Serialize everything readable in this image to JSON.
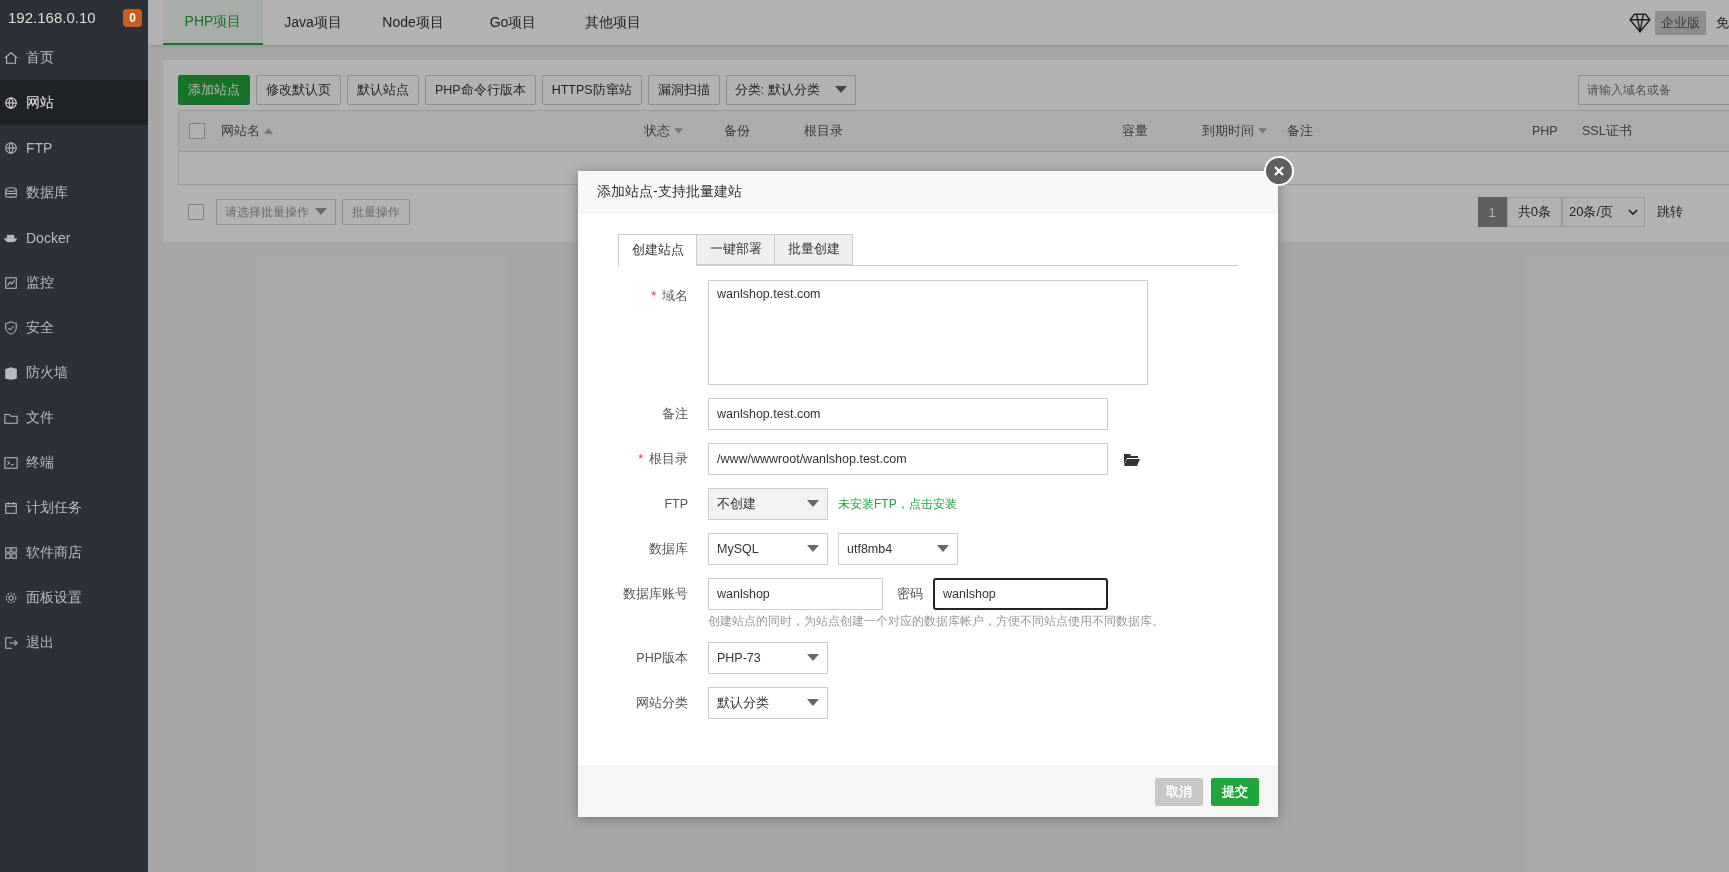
{
  "sidebar": {
    "host": "192.168.0.10",
    "badge": "0",
    "items": [
      {
        "label": "首页",
        "selected": false
      },
      {
        "label": "网站",
        "selected": true
      },
      {
        "label": "FTP",
        "selected": false
      },
      {
        "label": "数据库",
        "selected": false
      },
      {
        "label": "Docker",
        "selected": false
      },
      {
        "label": "监控",
        "selected": false
      },
      {
        "label": "安全",
        "selected": false
      },
      {
        "label": "防火墙",
        "selected": false
      },
      {
        "label": "文件",
        "selected": false
      },
      {
        "label": "终端",
        "selected": false
      },
      {
        "label": "计划任务",
        "selected": false
      },
      {
        "label": "软件商店",
        "selected": false
      },
      {
        "label": "面板设置",
        "selected": false
      },
      {
        "label": "退出",
        "selected": false
      }
    ]
  },
  "top_tabs": [
    {
      "label": "PHP项目",
      "selected": true
    },
    {
      "label": "Java项目",
      "selected": false
    },
    {
      "label": "Node项目",
      "selected": false
    },
    {
      "label": "Go项目",
      "selected": false
    },
    {
      "label": "其他项目",
      "selected": false
    }
  ],
  "edition": "企业版",
  "free": "免",
  "toolbar": {
    "buttons": [
      {
        "label": "添加站点",
        "primary": true
      },
      {
        "label": "修改默认页",
        "primary": false
      },
      {
        "label": "默认站点",
        "primary": false
      },
      {
        "label": "PHP命令行版本",
        "primary": false
      },
      {
        "label": "HTTPS防窜站",
        "primary": false
      },
      {
        "label": "漏洞扫描",
        "primary": false
      }
    ],
    "category": "分类: 默认分类",
    "search_placeholder": "请输入域名或备"
  },
  "table": {
    "checked": false,
    "columns": [
      {
        "label": "网站名",
        "sort_up": true
      },
      {
        "label": "状态",
        "sort_up": false
      },
      {
        "label": "备份"
      },
      {
        "label": "根目录"
      },
      {
        "label": "容量"
      },
      {
        "label": "到期时间",
        "sort_up": false
      },
      {
        "label": "备注"
      },
      {
        "label": "PHP"
      },
      {
        "label": "SSL证书"
      }
    ]
  },
  "footer": {
    "checked": false,
    "batch_select": "请选择批量操作",
    "batch_button": "批量操作",
    "page": "1",
    "total": "共0条",
    "per_page": "20条/页",
    "jump": "跳转"
  },
  "dialog": {
    "title": "添加站点-支持批量建站",
    "tabs": [
      {
        "label": "创建站点",
        "selected": true
      },
      {
        "label": "一键部署",
        "selected": false
      },
      {
        "label": "批量创建",
        "selected": false
      }
    ],
    "rows": [
      {
        "label": "域名",
        "required_mark": "*",
        "controls": [
          {
            "kind": "textarea",
            "value": "wanlshop.test.com"
          }
        ]
      },
      {
        "label": "备注",
        "controls": [
          {
            "kind": "input",
            "value": "wanlshop.test.com",
            "wide": true
          }
        ]
      },
      {
        "label": "根目录",
        "required_mark": "*",
        "controls": [
          {
            "kind": "input",
            "value": "/www/wwwroot/wanlshop.test.com",
            "wide": true
          },
          {
            "kind": "folder"
          }
        ]
      },
      {
        "label": "FTP",
        "controls": [
          {
            "kind": "select",
            "value": "不创建",
            "disabled": true
          },
          {
            "kind": "link",
            "value": "未安装FTP，点击安装"
          }
        ]
      },
      {
        "label": "数据库",
        "controls": [
          {
            "kind": "select",
            "value": "MySQL",
            "disabled": false
          },
          {
            "kind": "select",
            "value": "utf8mb4",
            "disabled": false
          }
        ]
      },
      {
        "label": "数据库账号",
        "controls": [
          {
            "kind": "input",
            "value": "wanlshop",
            "wide": false,
            "focused": false
          },
          {
            "kind": "label",
            "value": "密码"
          },
          {
            "kind": "input",
            "value": "wanlshop",
            "wide": false,
            "focused": true
          }
        ],
        "hint": "创建站点的同时，为站点创建一个对应的数据库帐户，方便不同站点使用不同数据库。"
      },
      {
        "label": "PHP版本",
        "controls": [
          {
            "kind": "select",
            "value": "PHP-73",
            "disabled": false
          }
        ]
      },
      {
        "label": "网站分类",
        "controls": [
          {
            "kind": "select",
            "value": "默认分类",
            "disabled": false
          }
        ]
      }
    ],
    "buttons": [
      {
        "label": "取消",
        "disabled": true
      },
      {
        "label": "提交",
        "disabled": false
      }
    ]
  }
}
